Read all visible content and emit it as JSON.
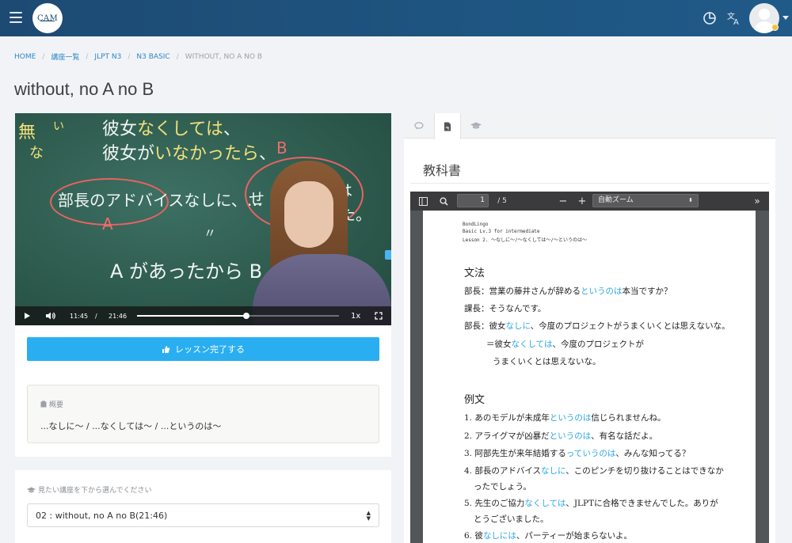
{
  "header": {
    "logo_text": "CAM",
    "icons": [
      "menu-icon",
      "pie-chart-icon",
      "translate-icon",
      "user-avatar-icon"
    ],
    "accent": "#1e5581"
  },
  "breadcrumb": {
    "items": [
      {
        "label": "HOME"
      },
      {
        "label": "講座一覧"
      },
      {
        "label": "JLPT N3"
      },
      {
        "label": "N3 BASIC"
      },
      {
        "label": "WITHOUT, NO A NO B"
      }
    ]
  },
  "page": {
    "title": "without, no A no B"
  },
  "video": {
    "current_time": "11:45",
    "separator": "/",
    "duration": "21:46",
    "speed": "1x",
    "progress": 0.54,
    "board": {
      "line1_prefix": "彼女",
      "line1_hl": "なくしては",
      "line1_suffix": "、",
      "line2_prefix": "彼女が",
      "line2_hl": "いなかったら",
      "line2_suffix": "、",
      "line3": "部長のアドバイスなしに、…",
      "line3b": "せ",
      "line3c": "は",
      "line3d": "た。",
      "line4": "A があったから B",
      "side_a": "無",
      "side_b": "い",
      "side_c": "な",
      "label_a": "A",
      "label_b": "B",
      "equals": "〃"
    }
  },
  "lesson": {
    "complete_label": "レッスン完了する",
    "summary_label": "概要",
    "summary_text": "...なしに～ / ...なくしては～ / ...というのは～"
  },
  "course_select": {
    "label": "見たい講座を下から選んでください",
    "selected": "02 : without, no A no B(21:46)"
  },
  "textbook": {
    "title": "教科書",
    "page_current": "1",
    "page_total": "/ 5",
    "zoom": "自動ズーム",
    "header_lines": [
      "BondLingo",
      "Basic Lv.3 for intermediate",
      "Lesson 2. ～なしに～/～なくしては～/～というのは～"
    ],
    "section_grammar": "文法",
    "section_examples": "例文",
    "grammar_lines": [
      {
        "pre": "部長：営業の藤井さんが辞める",
        "hl": "というのは",
        "post": "本当ですか？"
      },
      {
        "pre": "課長：そうなんです。",
        "hl": "",
        "post": ""
      },
      {
        "pre": "部長：彼女",
        "hl": "なしに",
        "post": "、今度のプロジェクトがうまくいくとは思えないな。"
      },
      {
        "pre": "＝彼女",
        "hl": "なくしては",
        "post": "、今度のプロジェクトが"
      },
      {
        "pre": "うまくいくとは思えないな。",
        "hl": "",
        "post": ""
      }
    ],
    "example_lines": [
      {
        "pre": "1. あのモデルが未成年",
        "hl": "というのは",
        "post": "信じられませんね。"
      },
      {
        "pre": "2. アライグマが凶暴だ",
        "hl": "というのは",
        "post": "、有名な話だよ。"
      },
      {
        "pre": "3. 阿部先生が来年結婚する",
        "hl": "っていうのは",
        "post": "、みんな知ってる？"
      },
      {
        "pre": "4. 部長のアドバイス",
        "hl": "なしに",
        "post": "、このピンチを切り抜けることはできなか"
      },
      {
        "pre": "ったでしょう。",
        "hl": "",
        "post": ""
      },
      {
        "pre": "5. 先生のご協力",
        "hl": "なくしては",
        "post": "、JLPTに合格できませんでした。ありが"
      },
      {
        "pre": "とうございました。",
        "hl": "",
        "post": ""
      },
      {
        "pre": "6. 彼",
        "hl": "なしには",
        "post": "、パーティーが始まらないよ。"
      }
    ]
  }
}
